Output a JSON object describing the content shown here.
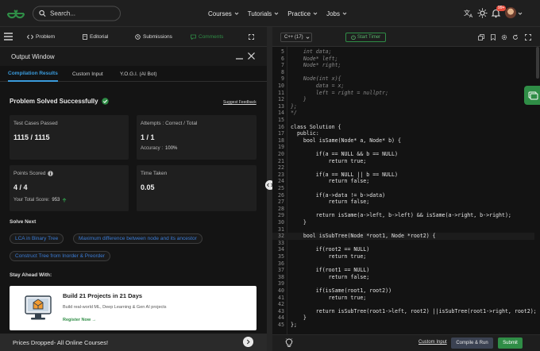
{
  "navbar": {
    "search_placeholder": "Search...",
    "links": [
      {
        "label": "Courses"
      },
      {
        "label": "Tutorials"
      },
      {
        "label": "Practice"
      },
      {
        "label": "Jobs"
      }
    ],
    "notification_count": "99+"
  },
  "left_tabs": {
    "problem": "Problem",
    "editorial": "Editorial",
    "submissions": "Submissions",
    "comments": "Comments"
  },
  "output_window": {
    "title": "Output Window",
    "tabs": [
      "Compilation Results",
      "Custom Input",
      "Y.O.G.I. (AI Bot)"
    ]
  },
  "result": {
    "status": "Problem Solved Successfully",
    "feedback_link": "Suggest Feedback",
    "test_cases_label": "Test Cases Passed",
    "test_cases_value": "1115 / 1115",
    "attempts_label": "Attempts : Correct / Total",
    "attempts_value": "1 / 1",
    "accuracy_label": "Accuracy :",
    "accuracy_value": "100%",
    "points_label": "Points Scored",
    "points_value": "4 / 4",
    "total_score_label": "Your Total Score:",
    "total_score_value": "953",
    "time_label": "Time Taken",
    "time_value": "0.05"
  },
  "solve_next": {
    "title": "Solve Next",
    "items": [
      "LCA in Binary Tree",
      "Maximum difference between node and its ancestor",
      "Construct Tree from Inorder & Preorder"
    ]
  },
  "stay_ahead": {
    "title": "Stay Ahead With:",
    "promo_title": "Build 21 Projects in 21 Days",
    "promo_subtitle": "Build real-world ML, Deep Learning & Gen AI projects",
    "promo_link": "Register Now →"
  },
  "prices_bar": "Prices Dropped- All Online Courses!",
  "editor": {
    "language": "C++ (17)",
    "timer": "Start Timer",
    "custom_input": "Custom Input",
    "compile_run": "Compile & Run",
    "submit": "Submit",
    "current_line": 32,
    "lines": [
      {
        "n": "5",
        "text": "    int data;",
        "comment": true
      },
      {
        "n": "6",
        "text": "    Node* left;",
        "comment": true
      },
      {
        "n": "7",
        "text": "    Node* right;",
        "comment": true
      },
      {
        "n": "8",
        "text": "",
        "comment": true
      },
      {
        "n": "9",
        "text": "    Node(int x){",
        "comment": true
      },
      {
        "n": "10",
        "text": "        data = x;",
        "comment": true
      },
      {
        "n": "11",
        "text": "        left = right = nullptr;",
        "comment": true
      },
      {
        "n": "12",
        "text": "    }",
        "comment": true
      },
      {
        "n": "13",
        "text": "};",
        "comment": true
      },
      {
        "n": "14",
        "text": "*/",
        "comment": true
      },
      {
        "n": "15",
        "text": "",
        "comment": false
      },
      {
        "n": "16",
        "text": "class Solution {",
        "comment": false
      },
      {
        "n": "17",
        "text": "  public:",
        "comment": false
      },
      {
        "n": "18",
        "text": "    bool isSame(Node* a, Node* b) {",
        "comment": false
      },
      {
        "n": "19",
        "text": "",
        "comment": false
      },
      {
        "n": "20",
        "text": "        if(a == NULL && b == NULL)",
        "comment": false
      },
      {
        "n": "21",
        "text": "            return true;",
        "comment": false
      },
      {
        "n": "22",
        "text": "",
        "comment": false
      },
      {
        "n": "23",
        "text": "        if(a == NULL || b == NULL)",
        "comment": false
      },
      {
        "n": "24",
        "text": "            return false;",
        "comment": false
      },
      {
        "n": "25",
        "text": "",
        "comment": false
      },
      {
        "n": "26",
        "text": "        if(a->data != b->data)",
        "comment": false
      },
      {
        "n": "27",
        "text": "            return false;",
        "comment": false
      },
      {
        "n": "28",
        "text": "",
        "comment": false
      },
      {
        "n": "29",
        "text": "        return isSame(a->left, b->left) && isSame(a->right, b->right);",
        "comment": false
      },
      {
        "n": "30",
        "text": "    }",
        "comment": false
      },
      {
        "n": "31",
        "text": "",
        "comment": false
      },
      {
        "n": "32",
        "text": "    bool isSubTree(Node *root1, Node *root2) {",
        "comment": false
      },
      {
        "n": "33",
        "text": "",
        "comment": false
      },
      {
        "n": "34",
        "text": "        if(root2 == NULL)",
        "comment": false
      },
      {
        "n": "35",
        "text": "            return true;",
        "comment": false
      },
      {
        "n": "36",
        "text": "",
        "comment": false
      },
      {
        "n": "37",
        "text": "        if(root1 == NULL)",
        "comment": false
      },
      {
        "n": "38",
        "text": "            return false;",
        "comment": false
      },
      {
        "n": "39",
        "text": "",
        "comment": false
      },
      {
        "n": "40",
        "text": "        if(isSame(root1, root2))",
        "comment": false
      },
      {
        "n": "41",
        "text": "            return true;",
        "comment": false
      },
      {
        "n": "42",
        "text": "",
        "comment": false
      },
      {
        "n": "43",
        "text": "        return isSubTree(root1->left, root2) ||isSubTree(root1->right, root2);",
        "comment": false
      },
      {
        "n": "44",
        "text": "    }",
        "comment": false
      },
      {
        "n": "45",
        "text": "};",
        "comment": false
      }
    ]
  },
  "colors": {
    "brand_green": "#2f8d46",
    "link_blue": "#3a7bd5",
    "tab_blue": "#3a9bdc"
  }
}
